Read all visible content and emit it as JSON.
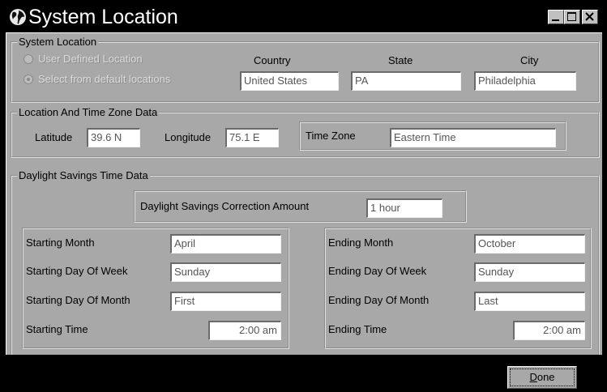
{
  "window": {
    "title": "System Location"
  },
  "system_location": {
    "group_label": "System Location",
    "radio_user_defined": "User Defined Location",
    "radio_default": "Select from default locations",
    "radio_selected": "default",
    "country_label": "Country",
    "state_label": "State",
    "city_label": "City",
    "country_value": "United States",
    "state_value": "PA",
    "city_value": "Philadelphia"
  },
  "location_time_zone": {
    "group_label": "Location And Time Zone Data",
    "latitude_label": "Latitude",
    "latitude_value": "39.6 N",
    "longitude_label": "Longitude",
    "longitude_value": "75.1 E",
    "time_zone_label": "Time Zone",
    "time_zone_value": "Eastern Time"
  },
  "daylight_savings": {
    "group_label": "Daylight Savings Time Data",
    "correction_label": "Daylight Savings Correction Amount",
    "correction_value": "1 hour",
    "starting_month_label": "Starting Month",
    "starting_month_value": "April",
    "starting_dow_label": "Starting Day Of Week",
    "starting_dow_value": "Sunday",
    "starting_dom_label": "Starting Day Of Month",
    "starting_dom_value": "First",
    "starting_time_label": "Starting Time",
    "starting_time_value": "2:00 am",
    "ending_month_label": "Ending Month",
    "ending_month_value": "October",
    "ending_dow_label": "Ending Day Of Week",
    "ending_dow_value": "Sunday",
    "ending_dom_label": "Ending Day Of Month",
    "ending_dom_value": "Last",
    "ending_time_label": "Ending Time",
    "ending_time_value": "2:00 am"
  },
  "buttons": {
    "done_first": "D",
    "done_rest": "one"
  },
  "icons": {
    "app": "globe-icon",
    "minimize": "minimize-icon",
    "maximize": "maximize-icon",
    "close": "close-icon"
  },
  "colors": {
    "dialog_bg": "#a8a8a8",
    "title_bg": "#000000",
    "title_text": "#ffffff"
  }
}
